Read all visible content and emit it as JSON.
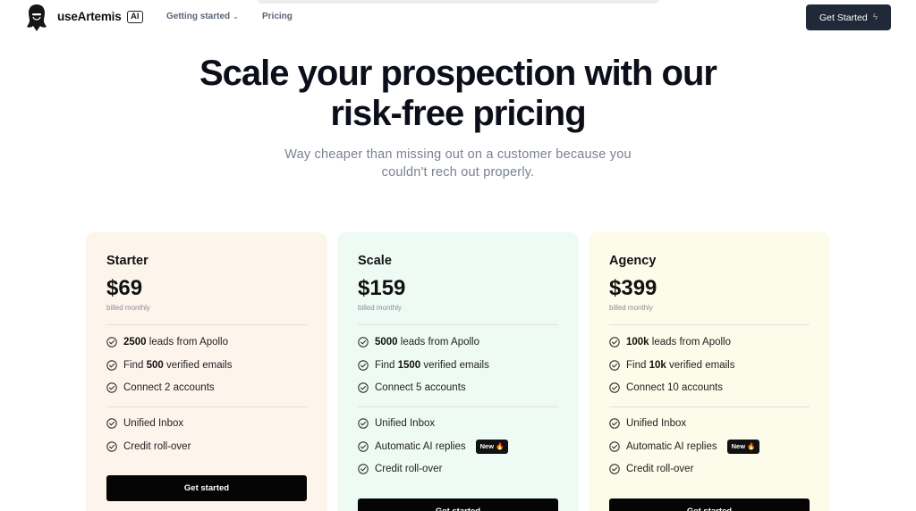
{
  "header": {
    "brand": "useArtemis",
    "ai_badge": "AI",
    "nav": [
      "Getting started",
      "Pricing"
    ],
    "cta": "Get Started",
    "cta_icon": "bolt-icon",
    "logo_icon": "artemis-portrait-logo"
  },
  "hero": {
    "title_line1": "Scale your prospection with our",
    "title_line2": "risk-free pricing",
    "subtitle_line1": "Way cheaper than missing out on a customer because you",
    "subtitle_line2": "couldn't rech out properly."
  },
  "plans": [
    {
      "name": "Starter",
      "price": "$69",
      "billing": "billed monthly",
      "features": [
        {
          "bold": "2500",
          "text": " leads from Apollo"
        },
        {
          "pre": "Find ",
          "bold": "500",
          "text": " verified emails"
        },
        {
          "text": "Connect 2 accounts"
        }
      ],
      "extras": [
        "Unified Inbox",
        "Credit roll-over"
      ],
      "button": "Get started"
    },
    {
      "name": "Scale",
      "price": "$159",
      "billing": "billed monthly",
      "features": [
        {
          "bold": "5000",
          "text": " leads from Apollo"
        },
        {
          "pre": "Find ",
          "bold": "1500",
          "text": " verified emails"
        },
        {
          "text": "Connect 5 accounts"
        }
      ],
      "extras": [
        "Unified Inbox",
        "Automatic AI replies",
        "Credit roll-over"
      ],
      "new_badge": "New 🔥",
      "button": "Get started"
    },
    {
      "name": "Agency",
      "price": "$399",
      "billing": "billed monthly",
      "features": [
        {
          "bold": "100k",
          "text": " leads from Apollo"
        },
        {
          "pre": "Find ",
          "bold": "10k",
          "text": " verified emails"
        },
        {
          "text": "Connect 10 accounts"
        }
      ],
      "extras": [
        "Unified Inbox",
        "Automatic AI replies",
        "Credit roll-over"
      ],
      "new_badge": "New 🔥",
      "button": "Get started"
    }
  ],
  "colors": {
    "starter_bg": "#fdf4ec",
    "scale_bg": "#eefbf4",
    "agency_bg": "#fdfbe9",
    "cta_bg": "#1f2937",
    "button_bg": "#050505"
  }
}
